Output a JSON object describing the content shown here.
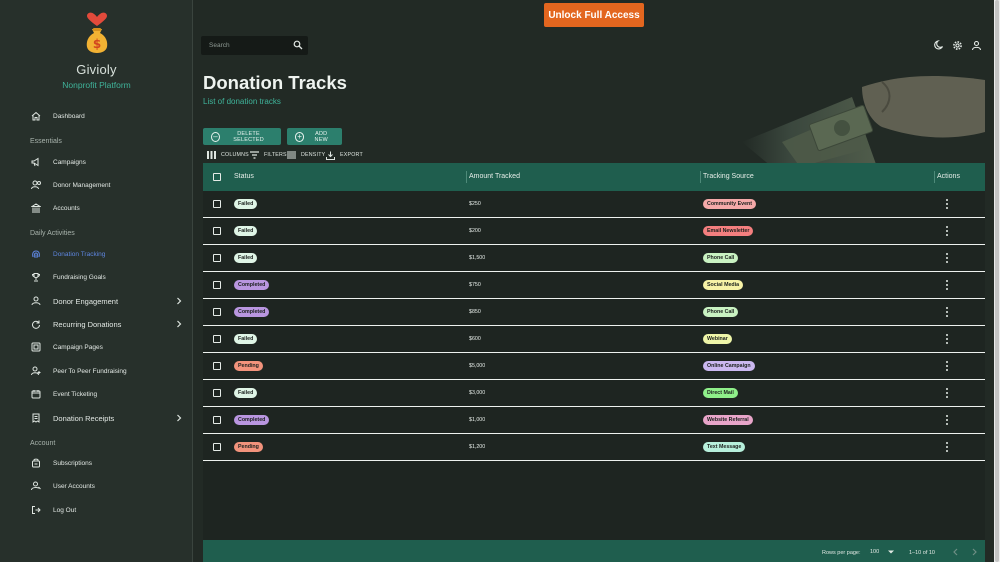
{
  "app": {
    "brand": "Givioly",
    "brand_sub": "Nonprofit Platform",
    "unlock_label": "Unlock Full Access"
  },
  "search": {
    "placeholder": "Search"
  },
  "sidebar": {
    "sections": {
      "essentials": "Essentials",
      "daily": "Daily Activities",
      "account": "Account"
    },
    "items": [
      {
        "label": "Dashboard",
        "icon": "home-icon"
      },
      {
        "label": "Campaigns",
        "icon": "megaphone-icon"
      },
      {
        "label": "Donor Management",
        "icon": "people-icon"
      },
      {
        "label": "Accounts",
        "icon": "bank-icon"
      },
      {
        "label": "Donation Tracking",
        "icon": "fingerprint-icon",
        "active": true
      },
      {
        "label": "Fundraising Goals",
        "icon": "trophy-icon"
      },
      {
        "label": "Donor Engagement",
        "icon": "person-icon",
        "expandable": true
      },
      {
        "label": "Recurring Donations",
        "icon": "cycle-icon",
        "expandable": true
      },
      {
        "label": "Campaign Pages",
        "icon": "page-icon"
      },
      {
        "label": "Peer To Peer Fundraising",
        "icon": "group-icon"
      },
      {
        "label": "Event Ticketing",
        "icon": "calendar-icon"
      },
      {
        "label": "Donation Receipts",
        "icon": "receipt-icon",
        "expandable": true
      },
      {
        "label": "Subscriptions",
        "icon": "box-icon"
      },
      {
        "label": "User Accounts",
        "icon": "user-icon"
      },
      {
        "label": "Log Out",
        "icon": "logout-icon"
      }
    ]
  },
  "header": {
    "title": "Donation Tracks",
    "subtitle": "List of donation tracks"
  },
  "actions": {
    "delete_label": "DELETE SELECTED",
    "add_label": "ADD NEW"
  },
  "toolbar": {
    "columns": "COLUMNS",
    "filters": "FILTERS",
    "density": "DENSITY",
    "export": "EXPORT"
  },
  "table": {
    "columns": [
      "Status",
      "Amount Tracked",
      "Tracking Source",
      "Actions"
    ],
    "rows": [
      {
        "status": "Failed",
        "amount": "$250",
        "source": "Community Event"
      },
      {
        "status": "Failed",
        "amount": "$200",
        "source": "Email Newsletter"
      },
      {
        "status": "Failed",
        "amount": "$1,500",
        "source": "Phone Call"
      },
      {
        "status": "Completed",
        "amount": "$750",
        "source": "Social Media"
      },
      {
        "status": "Completed",
        "amount": "$850",
        "source": "Phone Call"
      },
      {
        "status": "Failed",
        "amount": "$600",
        "source": "Webinar"
      },
      {
        "status": "Pending",
        "amount": "$5,000",
        "source": "Online Campaign"
      },
      {
        "status": "Failed",
        "amount": "$3,000",
        "source": "Direct Mail"
      },
      {
        "status": "Completed",
        "amount": "$1,000",
        "source": "Website Referral"
      },
      {
        "status": "Pending",
        "amount": "$1,200",
        "source": "Text Message"
      }
    ],
    "footer": {
      "rows_per_page_label": "Rows per page:",
      "rows_per_page": "100",
      "range": "1–10 of 10"
    }
  },
  "colors": {
    "accent": "#2c7f6d",
    "header": "#1f5e4e",
    "unlock": "#e3661f",
    "status": {
      "Failed": "#dff5e6",
      "Completed": "#b996e0",
      "Pending": "#f2937c"
    },
    "source": {
      "Community Event": "#f5a9a9",
      "Email Newsletter": "#f47f7f",
      "Phone Call": "#c9f2c2",
      "Social Media": "#f7f2a6",
      "Webinar": "#eef5a8",
      "Online Campaign": "#cbb8f0",
      "Direct Mail": "#8ff08a",
      "Website Referral": "#e8a5c9",
      "Text Message": "#b7f0dc"
    }
  }
}
